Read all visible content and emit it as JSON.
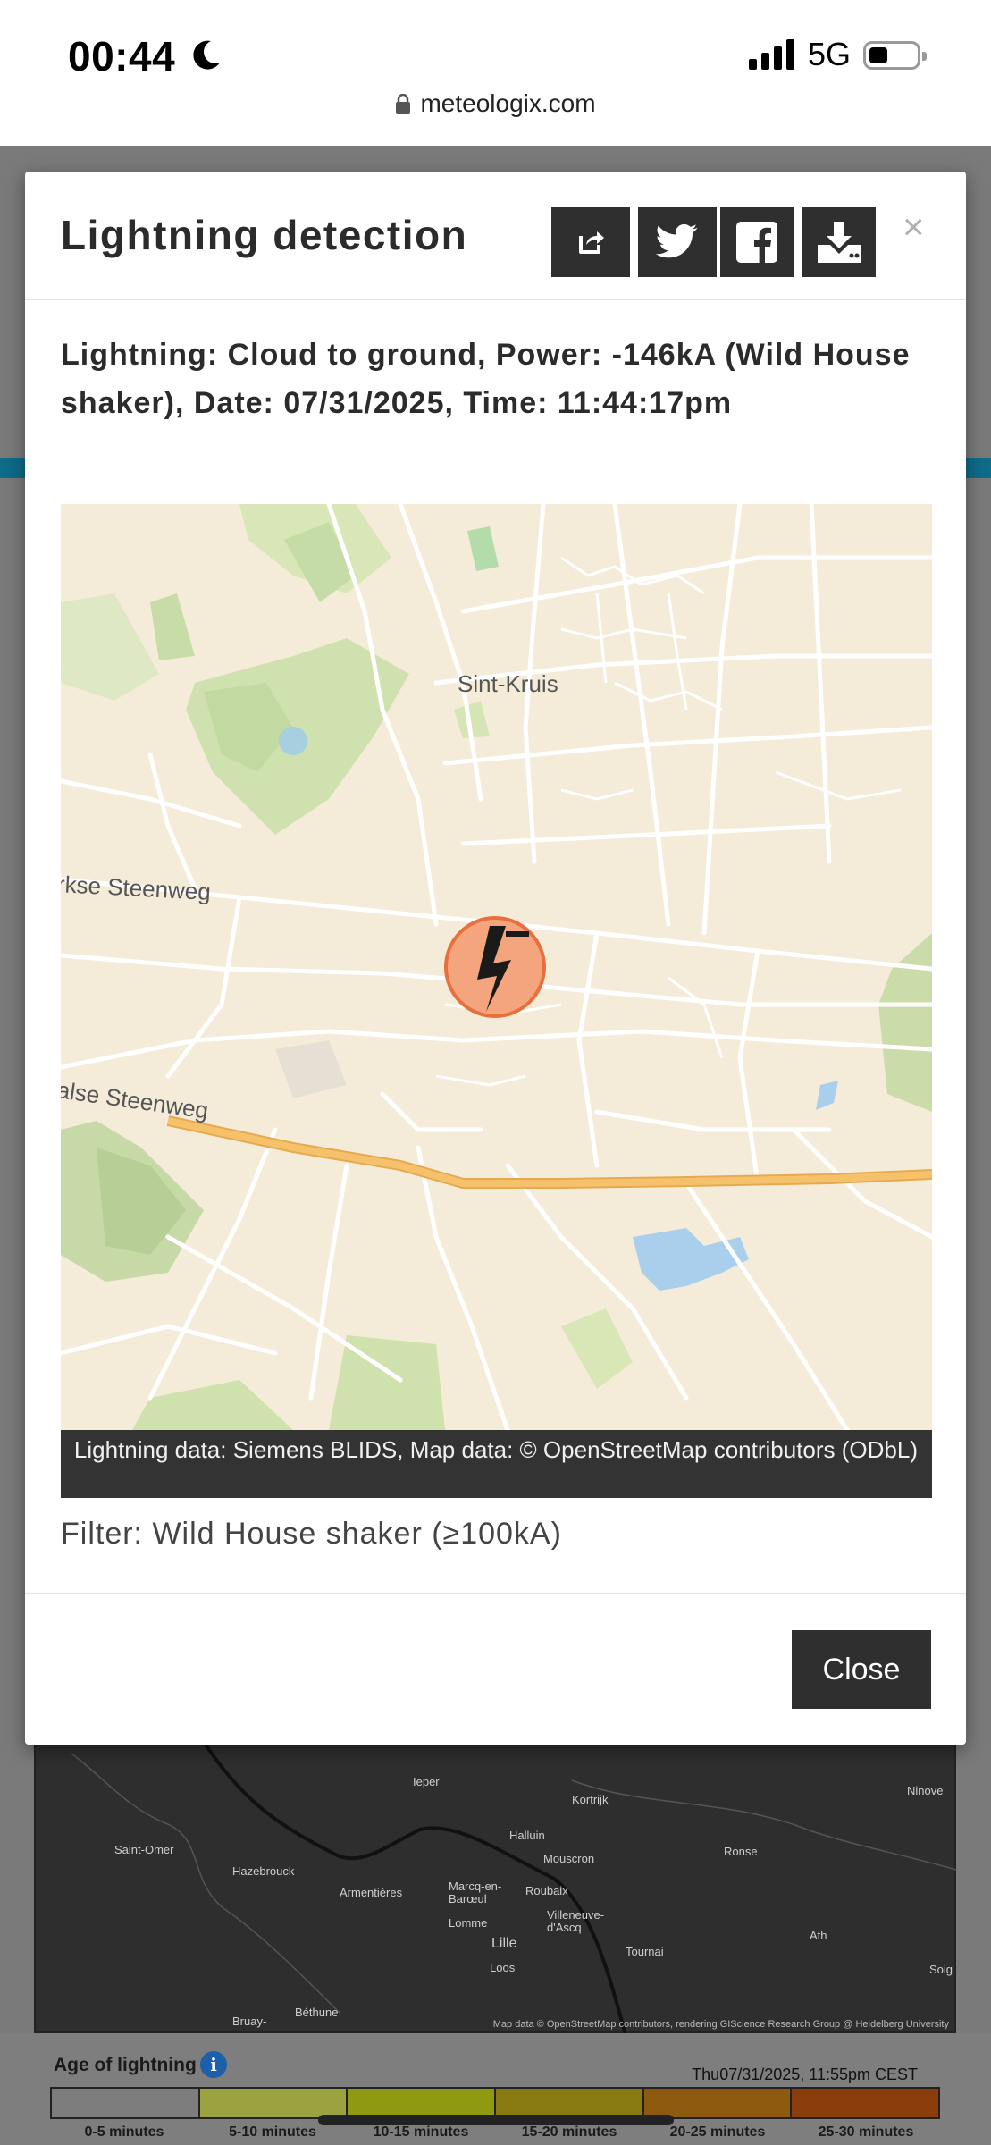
{
  "status_bar": {
    "time": "00:44",
    "network": "5G"
  },
  "address_bar": {
    "url": "meteologix.com"
  },
  "modal": {
    "title": "Lightning detection",
    "lightning_info": "Lightning: Cloud to ground, Power: -146kA (Wild House shaker), Date: 07/31/2025, Time: 11:44:17pm",
    "map": {
      "labels": {
        "place": "Sint-Kruis",
        "road_1": "rkse Steenweg",
        "road_2": "alse Steenweg"
      },
      "attribution": "Lightning data: Siemens BLIDS, Map data: © OpenStreetMap contributors (ODbL)"
    },
    "filter": "Filter: Wild House shaker (≥100kA)",
    "close_label": "Close",
    "close_x": "×"
  },
  "background_map": {
    "places": [
      "Ieper",
      "Kortrijk",
      "Ninove",
      "Saint-Omer",
      "Hazebrouck",
      "Halluin",
      "Mouscron",
      "Ronse",
      "Armentières",
      "Marcq-en-Barœul",
      "Roubaix",
      "Lomme",
      "Lille",
      "Villeneuve-d'Ascq",
      "Tournai",
      "Ath",
      "Loos",
      "Béthune",
      "Bruay-",
      "Soig"
    ],
    "credit": "Map data © OpenStreetMap contributors, rendering GIScience Research Group @ Heidelberg University"
  },
  "legend": {
    "title": "Age of lightning",
    "timestamp": "Thu07/31/2025, 11:55pm CEST",
    "items": [
      {
        "label": "0-5 minutes",
        "color": "#7d7d7d"
      },
      {
        "label": "5-10 minutes",
        "color": "#9aa33f"
      },
      {
        "label": "10-15 minutes",
        "color": "#8f9a10"
      },
      {
        "label": "15-20 minutes",
        "color": "#8a7a12"
      },
      {
        "label": "20-25 minutes",
        "color": "#8e5a10"
      },
      {
        "label": "25-30 minutes",
        "color": "#8c3d0c"
      }
    ]
  },
  "colors": {
    "button_dark": "#2f2f2f",
    "map_base": "#f4ecd9",
    "highway": "#f5c26b",
    "marker": "#f4a57d"
  }
}
